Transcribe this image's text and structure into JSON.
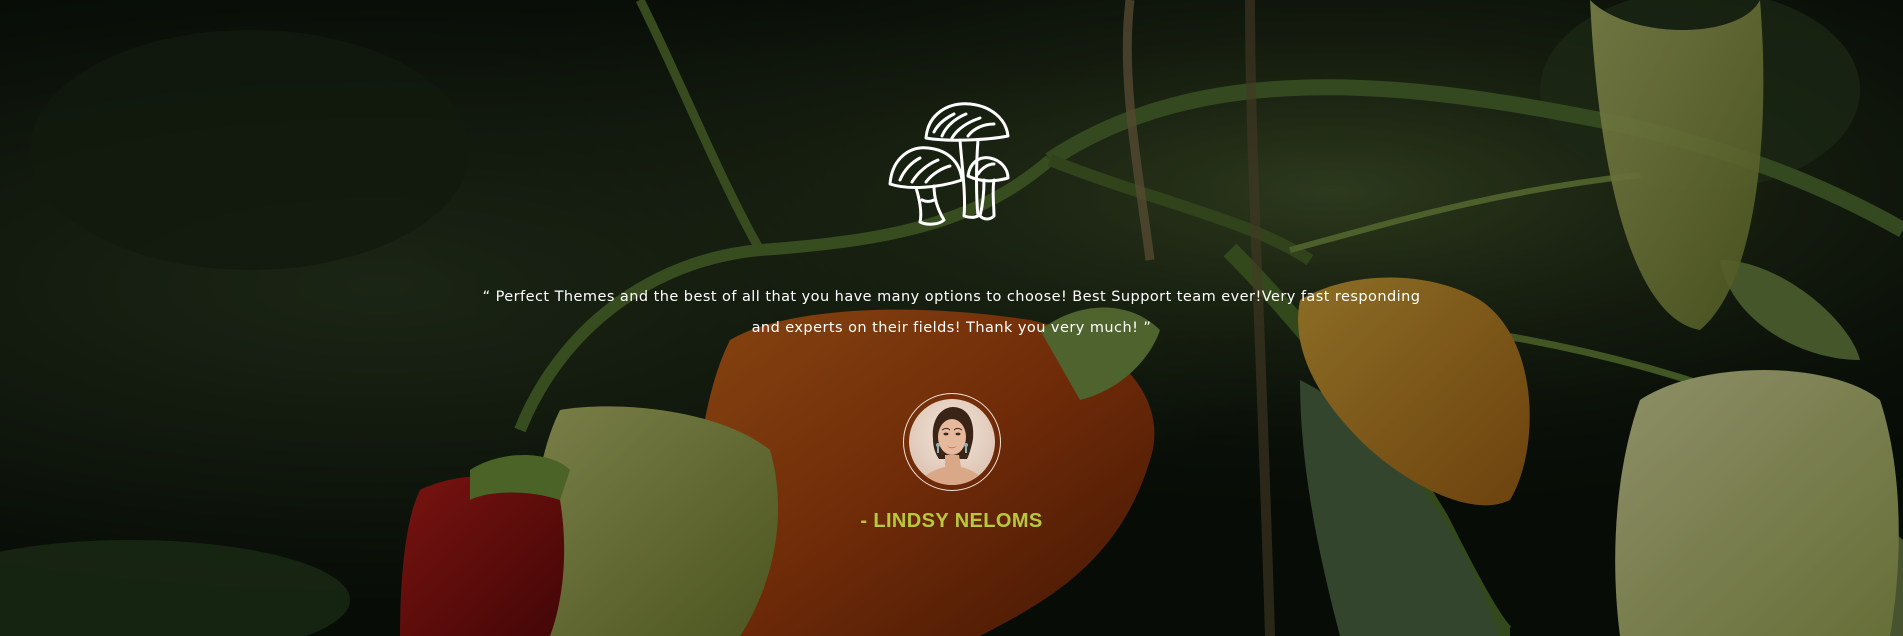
{
  "testimonial": {
    "icon": "mushroom-icon",
    "quote": "“ Perfect Themes and the best of all that you have many options to choose! Best Support team ever!Very fast responding and experts on their fields! Thank you very much! ”",
    "author": "- LINDSY NELOMS",
    "author_color": "#b7c93c"
  },
  "background": {
    "description_icon": "pepper-plant-photo"
  }
}
